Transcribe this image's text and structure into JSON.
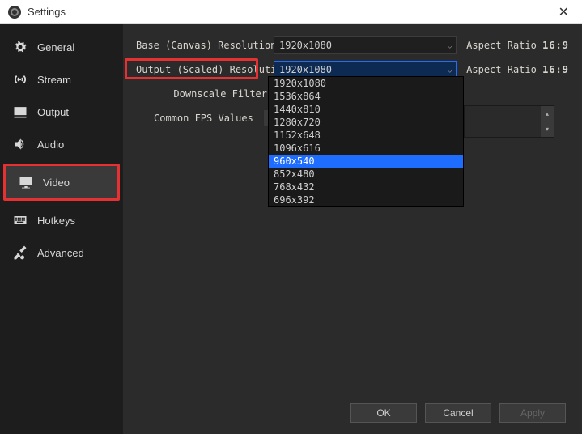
{
  "window": {
    "title": "Settings"
  },
  "sidebar": {
    "items": [
      {
        "label": "General"
      },
      {
        "label": "Stream"
      },
      {
        "label": "Output"
      },
      {
        "label": "Audio"
      },
      {
        "label": "Video"
      },
      {
        "label": "Hotkeys"
      },
      {
        "label": "Advanced"
      }
    ]
  },
  "form": {
    "base_label": "Base (Canvas) Resolution",
    "base_value": "1920x1080",
    "output_label": "Output (Scaled) Resolution",
    "output_value": "1920x1080",
    "aspect_label": "Aspect Ratio",
    "aspect_value": "16:9",
    "filter_label": "Downscale Filter",
    "fps_label": "Common FPS Values"
  },
  "dropdown": {
    "options": [
      "1920x1080",
      "1536x864",
      "1440x810",
      "1280x720",
      "1152x648",
      "1096x616",
      "960x540",
      "852x480",
      "768x432",
      "696x392"
    ],
    "selected_index": 6
  },
  "buttons": {
    "ok": "OK",
    "cancel": "Cancel",
    "apply": "Apply"
  }
}
